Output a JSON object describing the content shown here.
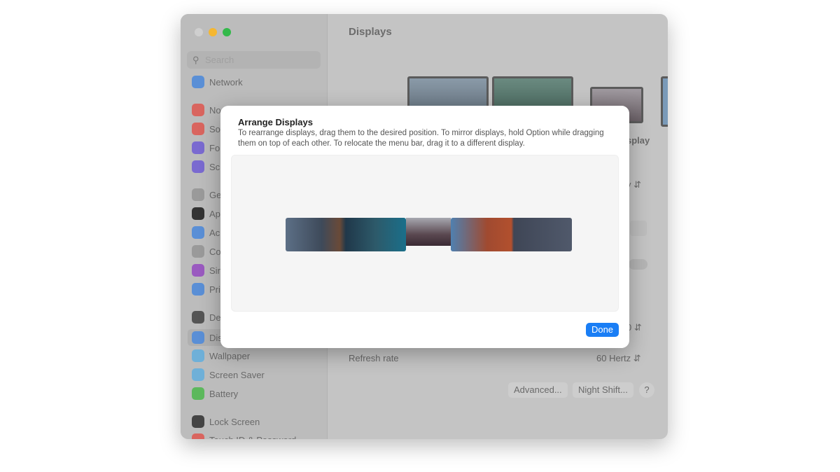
{
  "window": {
    "title": "Displays",
    "search_placeholder": "Search"
  },
  "sidebar": {
    "items": [
      {
        "label": "Network",
        "color": "#5a8fd6"
      },
      {
        "label": "No",
        "color": "#d9655f"
      },
      {
        "label": "So",
        "color": "#d9655f"
      },
      {
        "label": "Fo",
        "color": "#7a6ad0"
      },
      {
        "label": "Sc",
        "color": "#7a6ad0"
      },
      {
        "label": "Ge",
        "color": "#9a9a9a"
      },
      {
        "label": "Ap",
        "color": "#333333"
      },
      {
        "label": "Ac",
        "color": "#5a8fd6"
      },
      {
        "label": "Co",
        "color": "#9a9a9a"
      },
      {
        "label": "Sir",
        "color": "#9a5ac0"
      },
      {
        "label": "Pri",
        "color": "#5a8fd6"
      },
      {
        "label": "De",
        "color": "#555555"
      },
      {
        "label": "Dis",
        "color": "#5a8fd6"
      },
      {
        "label": "Wallpaper",
        "color": "#6fb0d8"
      },
      {
        "label": "Screen Saver",
        "color": "#6fb0d8"
      },
      {
        "label": "Battery",
        "color": "#5cb85c"
      },
      {
        "label": "Lock Screen",
        "color": "#444444"
      },
      {
        "label": "Touch ID & Password",
        "color": "#d9655f"
      }
    ]
  },
  "main": {
    "display_label_partial": "splay",
    "row_value_1": "y",
    "row_value_2": "0",
    "refresh_rate_label": "Refresh rate",
    "refresh_rate_value": "60 Hertz",
    "advanced_button": "Advanced...",
    "night_shift_button": "Night Shift...",
    "help_button": "?"
  },
  "dialog": {
    "title": "Arrange Displays",
    "description": "To rearrange displays, drag them to the desired position. To mirror displays, hold Option while dragging them on top of each other. To relocate the menu bar, drag it to a different display.",
    "done_label": "Done",
    "accent": "#1a7ef5"
  }
}
